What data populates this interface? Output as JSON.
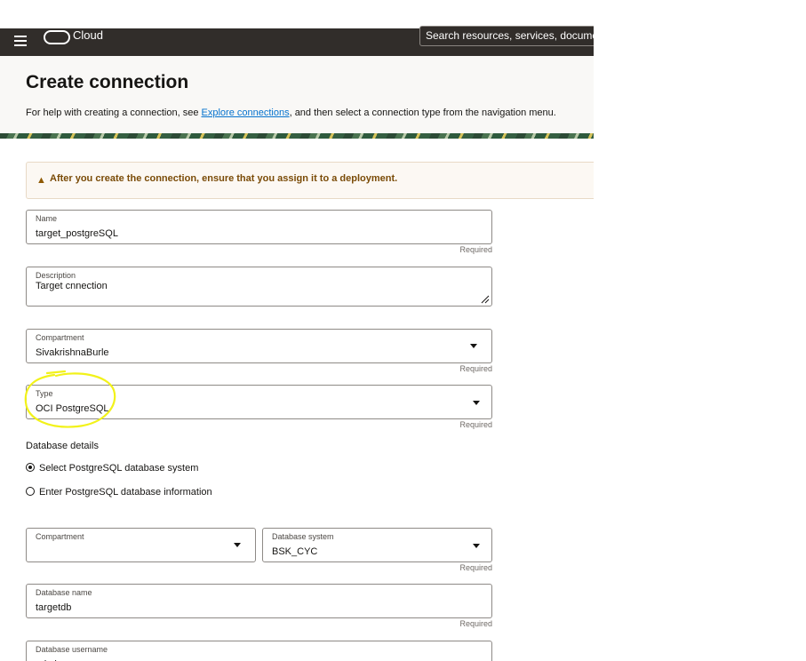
{
  "topbar": {
    "brand": "Cloud",
    "search_placeholder": "Search resources, services, documentation, and Marketplace"
  },
  "header": {
    "title": "Create connection",
    "help_prefix": "For help with creating a connection, see ",
    "help_link": "Explore connections",
    "help_suffix": ", and then select a connection type from the navigation menu."
  },
  "warning": {
    "icon": "warning-triangle-icon",
    "text": "After you create the connection, ensure that you assign it to a deployment."
  },
  "fields": {
    "name": {
      "label": "Name",
      "value": "target_postgreSQL",
      "required": "Required"
    },
    "description": {
      "label": "Description",
      "value": "Target cnnection"
    },
    "compartment": {
      "label": "Compartment",
      "value": "SivakrishnaBurle",
      "required": "Required"
    },
    "type": {
      "label": "Type",
      "value": "OCI PostgreSQL",
      "required": "Required"
    }
  },
  "database_details": {
    "title": "Database details",
    "options": [
      {
        "label": "Select PostgreSQL database system",
        "selected": true
      },
      {
        "label": "Enter PostgreSQL database information",
        "selected": false
      }
    ],
    "compartment": {
      "label": "Compartment",
      "value": ""
    },
    "database_system": {
      "label": "Database system",
      "value": "BSK_CYC",
      "required": "Required"
    },
    "database_name": {
      "label": "Database name",
      "value": "targetdb",
      "required": "Required"
    },
    "database_username": {
      "label": "Database username",
      "value": "admin"
    }
  },
  "annotation": {
    "color": "#f2f21a"
  }
}
